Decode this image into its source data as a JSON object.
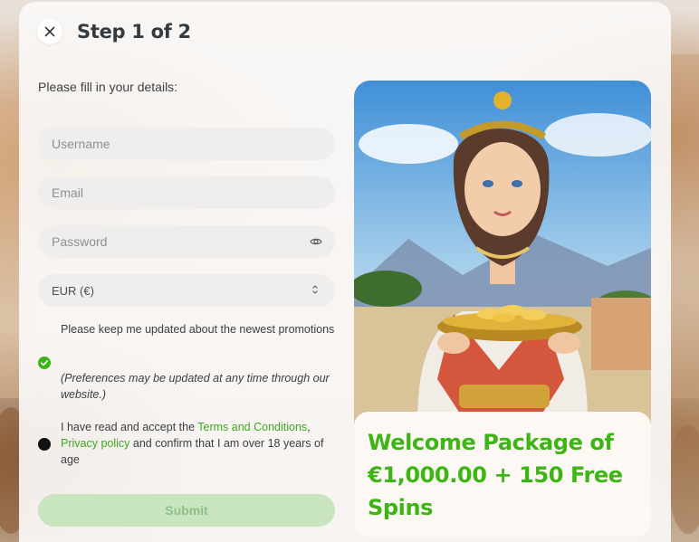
{
  "header": {
    "step_title": "Step 1 of 2"
  },
  "form": {
    "intro": "Please fill in your details:",
    "username_placeholder": "Username",
    "email_placeholder": "Email",
    "password_placeholder": "Password",
    "currency_value": "EUR (€)",
    "promo_opt_in": {
      "label": "Please keep me updated about the newest promotions",
      "note": "(Preferences may be updated at any time through our website.)",
      "checked": true
    },
    "terms": {
      "text_before": "I have read and accept the ",
      "terms_link": "Terms and Conditions",
      "separator": ",",
      "privacy_link": "Privacy policy",
      "text_after": " and confirm that I am over 18 years of age",
      "checked": false
    },
    "submit_label": "Submit"
  },
  "promo": {
    "headline": "Welcome Package of €1,000.00 + 150 Free Spins"
  },
  "colors": {
    "accent_green": "#3cb515",
    "link_green": "#3da81c",
    "submit_disabled_bg": "#c9e5c0",
    "field_bg": "#efeeec"
  },
  "icons": [
    "close-icon",
    "eye-icon",
    "select-arrows-icon",
    "check-icon"
  ]
}
